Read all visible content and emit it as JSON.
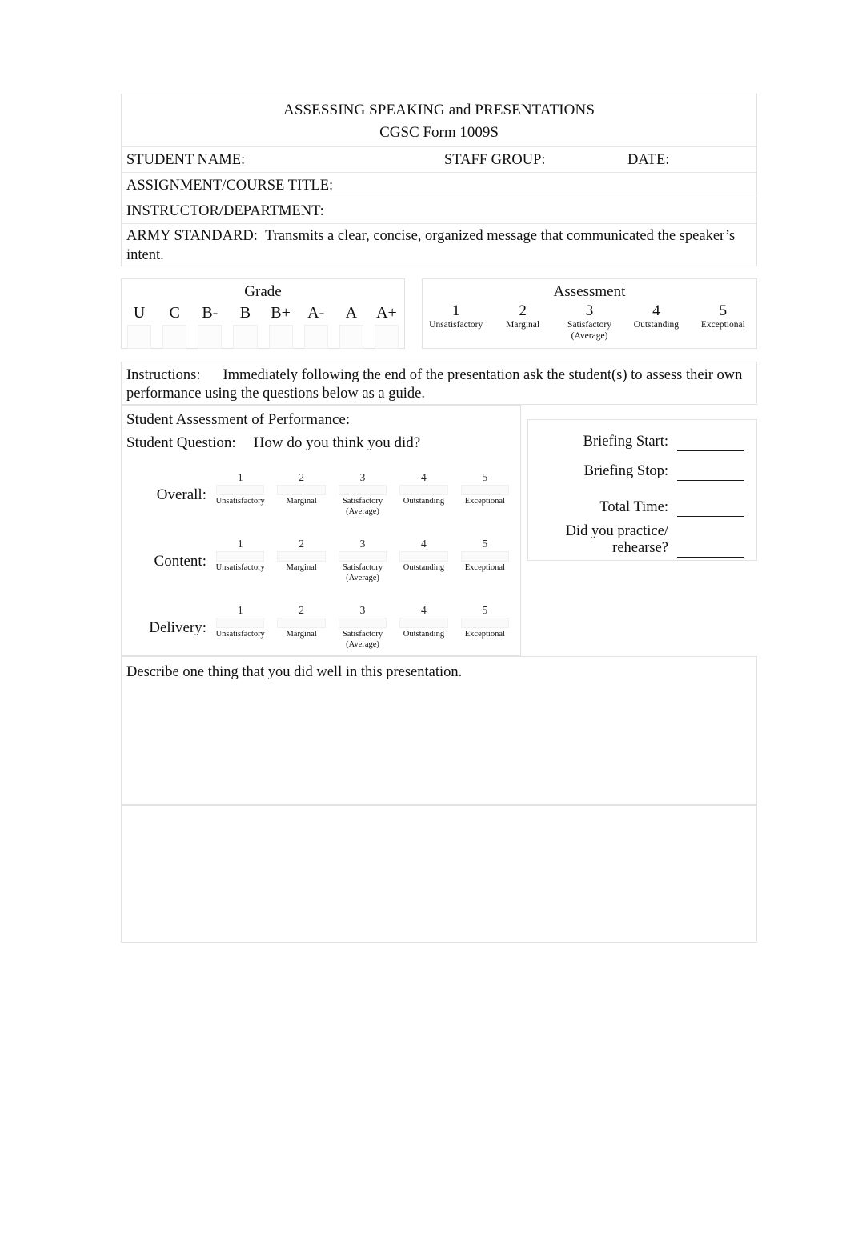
{
  "document": {
    "title": "ASSESSING SPEAKING and PRESENTATIONS",
    "subtitle": "CGSC Form 1009S"
  },
  "header": {
    "student_name_label": "STUDENT NAME:",
    "staff_group_label": "STAFF GROUP:",
    "date_label": "DATE:",
    "assignment_label": "ASSIGNMENT/COURSE TITLE:",
    "instructor_label": "INSTRUCTOR/DEPARTMENT:",
    "army_standard_label": "ARMY STANDARD:",
    "army_standard_text": "Transmits a clear, concise, organized message that communicated the speaker’s intent."
  },
  "grade": {
    "caption": "Grade",
    "options": [
      "U",
      "C",
      "B-",
      "B",
      "B+",
      "A-",
      "A",
      "A+"
    ]
  },
  "assessment": {
    "caption": "Assessment",
    "levels": [
      {
        "num": "1",
        "word": "Unsatisfactory",
        "word2": ""
      },
      {
        "num": "2",
        "word": "Marginal",
        "word2": ""
      },
      {
        "num": "3",
        "word": "Satisfactory",
        "word2": "(Average)"
      },
      {
        "num": "4",
        "word": "Outstanding",
        "word2": ""
      },
      {
        "num": "5",
        "word": "Exceptional",
        "word2": ""
      }
    ]
  },
  "instructions": {
    "label": "Instructions:",
    "text": "Immediately following the end of the presentation ask the student(s) to assess their own performance using the questions below as a guide."
  },
  "student_assessment": {
    "heading": "Student Assessment of Performance:",
    "question_label": "Student Question:",
    "question_text": "How do you think you did?",
    "scales": [
      {
        "label": "Overall:",
        "levels": [
          {
            "num": "1",
            "word": "Unsatisfactory",
            "word2": ""
          },
          {
            "num": "2",
            "word": "Marginal",
            "word2": ""
          },
          {
            "num": "3",
            "word": "Satisfactory",
            "word2": "(Average)"
          },
          {
            "num": "4",
            "word": "Outstanding",
            "word2": ""
          },
          {
            "num": "5",
            "word": "Exceptional",
            "word2": ""
          }
        ]
      },
      {
        "label": "Content:",
        "levels": [
          {
            "num": "1",
            "word": "Unsatisfactory",
            "word2": ""
          },
          {
            "num": "2",
            "word": "Marginal",
            "word2": ""
          },
          {
            "num": "3",
            "word": "Satisfactory",
            "word2": "(Average)"
          },
          {
            "num": "4",
            "word": "Outstanding",
            "word2": ""
          },
          {
            "num": "5",
            "word": "Exceptional",
            "word2": ""
          }
        ]
      },
      {
        "label": "Delivery:",
        "levels": [
          {
            "num": "1",
            "word": "Unsatisfactory",
            "word2": ""
          },
          {
            "num": "2",
            "word": "Marginal",
            "word2": ""
          },
          {
            "num": "3",
            "word": "Satisfactory",
            "word2": "(Average)"
          },
          {
            "num": "4",
            "word": "Outstanding",
            "word2": ""
          },
          {
            "num": "5",
            "word": "Exceptional",
            "word2": ""
          }
        ]
      }
    ]
  },
  "briefing": {
    "rows": [
      {
        "label": "Briefing Start:",
        "value": ""
      },
      {
        "label": "Briefing Stop:",
        "value": ""
      },
      {
        "label": "Total Time:",
        "value": ""
      },
      {
        "label_line1": "Did you practice/",
        "label_line2": "rehearse?",
        "value": ""
      }
    ]
  },
  "comments": {
    "describe_prompt": "Describe one thing that you did well in this presentation.",
    "second_prompt_illegible": "",
    "synopsis_heading_illegible": ""
  },
  "footer": {
    "left_illegible": "",
    "right_illegible": ""
  },
  "colors": {
    "page_background": "#ffffff",
    "text": "#111111",
    "border": "#e2e2e2",
    "rule": "#1a1a1a",
    "faded_text": "#9a9a9a"
  }
}
